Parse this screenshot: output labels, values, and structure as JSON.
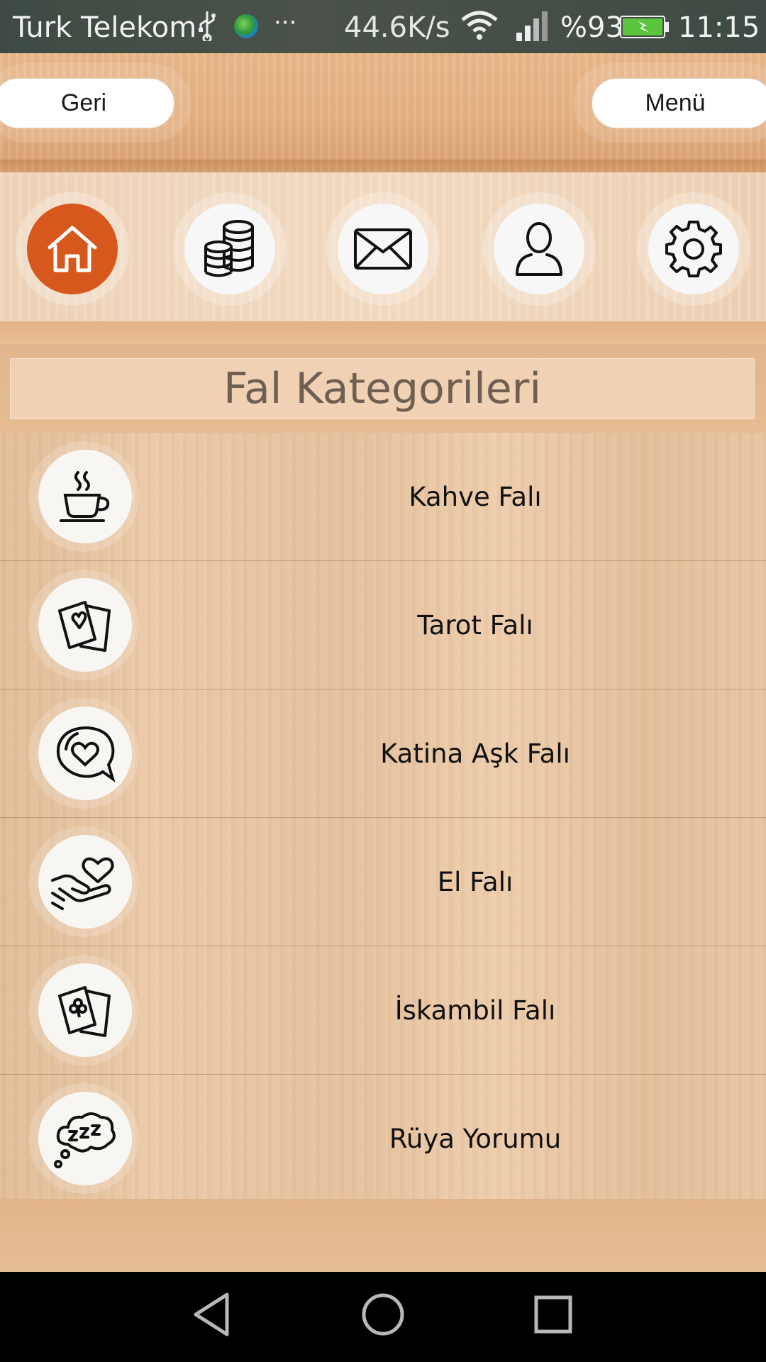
{
  "status_bar": {
    "carrier": "Turk Telekom",
    "more": "···",
    "speed": "44.6K/s",
    "battery": "%93",
    "time": "11:15",
    "icons": [
      "usb-icon",
      "globe-icon",
      "wifi-icon",
      "signal-icon",
      "battery-icon"
    ]
  },
  "header": {
    "back_label": "Geri",
    "menu_label": "Menü"
  },
  "nav": {
    "items": [
      {
        "name": "home",
        "icon": "home-icon",
        "active": true
      },
      {
        "name": "coins",
        "icon": "coins-icon",
        "active": false
      },
      {
        "name": "mail",
        "icon": "mail-icon",
        "active": false
      },
      {
        "name": "profile",
        "icon": "user-icon",
        "active": false
      },
      {
        "name": "settings",
        "icon": "gear-icon",
        "active": false
      }
    ],
    "active_color": "#d7581c"
  },
  "section": {
    "title": "Fal Kategorileri"
  },
  "categories": {
    "items": [
      {
        "label": "Kahve Falı",
        "icon": "coffee-cup-icon"
      },
      {
        "label": "Tarot Falı",
        "icon": "tarot-cards-icon"
      },
      {
        "label": "Katina Aşk Falı",
        "icon": "heart-bubble-icon"
      },
      {
        "label": "El Falı",
        "icon": "hand-heart-icon"
      },
      {
        "label": "İskambil Falı",
        "icon": "playing-cards-icon"
      },
      {
        "label": "Rüya Yorumu",
        "icon": "dream-cloud-icon"
      }
    ]
  },
  "colors": {
    "wood": "#e8c6a3",
    "accent": "#d7581c"
  }
}
